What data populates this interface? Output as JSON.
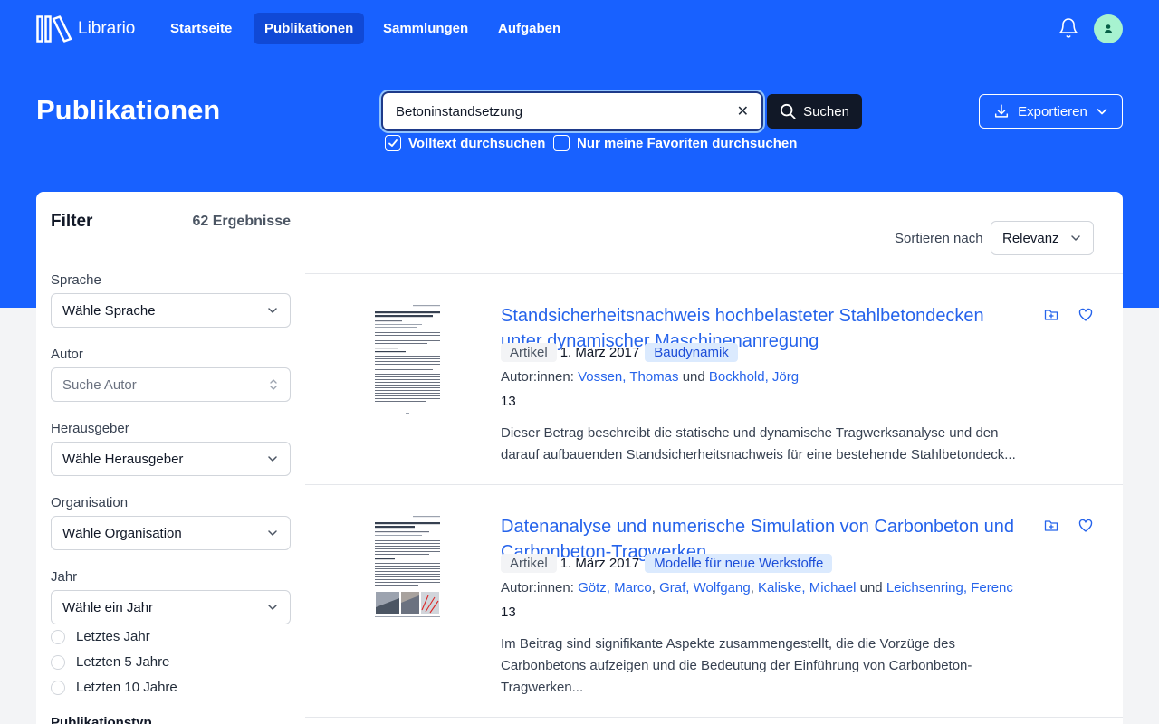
{
  "brand": {
    "name": "Librario"
  },
  "nav": [
    {
      "label": "Startseite",
      "active": false
    },
    {
      "label": "Publikationen",
      "active": true
    },
    {
      "label": "Sammlungen",
      "active": false
    },
    {
      "label": "Aufgaben",
      "active": false
    }
  ],
  "header": {
    "title": "Publikationen"
  },
  "search": {
    "value": "Betoninstandsetzung",
    "button_label": "Suchen",
    "fulltext_label": "Volltext durchsuchen",
    "fulltext_checked": true,
    "favorites_label": "Nur meine Favoriten durchsuchen",
    "favorites_checked": false
  },
  "export": {
    "label": "Exportieren"
  },
  "filter": {
    "title": "Filter",
    "result_count": "62 Ergebnisse",
    "language": {
      "label": "Sprache",
      "value": "Wähle Sprache"
    },
    "author": {
      "label": "Autor",
      "placeholder": "Suche Autor"
    },
    "publisher": {
      "label": "Herausgeber",
      "value": "Wähle Herausgeber"
    },
    "organization": {
      "label": "Organisation",
      "value": "Wähle Organisation"
    },
    "year": {
      "label": "Jahr",
      "value": "Wähle ein Jahr",
      "options": [
        "Letztes Jahr",
        "Letzten 5 Jahre",
        "Letzten 10 Jahre"
      ]
    },
    "pubtype": {
      "label": "Publikationstyp"
    }
  },
  "sort": {
    "label": "Sortieren nach",
    "value": "Relevanz"
  },
  "publications": [
    {
      "title": "Standsicherheitsnachweis hochbelasteter Stahlbetondecken unter dynamischer Maschinenanregung",
      "type": "Artikel",
      "date": "1. März 2017",
      "topic": "Baudynamik",
      "authors_label": "Autor:innen:",
      "authors": [
        "Vossen, Thomas",
        "Bockhold, Jörg"
      ],
      "pages": "13",
      "abstract": "Dieser Betrag beschreibt die statische und dynamische Tragwerksanalyse und den darauf aufbauenden Standsicherheitsnachweis für eine bestehende Stahlbetondeck..."
    },
    {
      "title": "Datenanalyse und numerische Simulation von Carbonbeton und Carbonbeton-Tragwerken",
      "type": "Artikel",
      "date": "1. März 2017",
      "topic": "Modelle für neue Werkstoffe",
      "authors_label": "Autor:innen:",
      "authors": [
        "Götz, Marco",
        "Graf, Wolfgang",
        "Kaliske, Michael",
        "Leichsenring, Ferenc"
      ],
      "pages": "13",
      "abstract": "Im Beitrag sind signifikante Aspekte zusammengestellt, die die Vorzüge des Carbonbetons aufzeigen und die Bedeutung der Einführung von Carbonbeton-Tragwerken..."
    }
  ],
  "conjunction": "und"
}
